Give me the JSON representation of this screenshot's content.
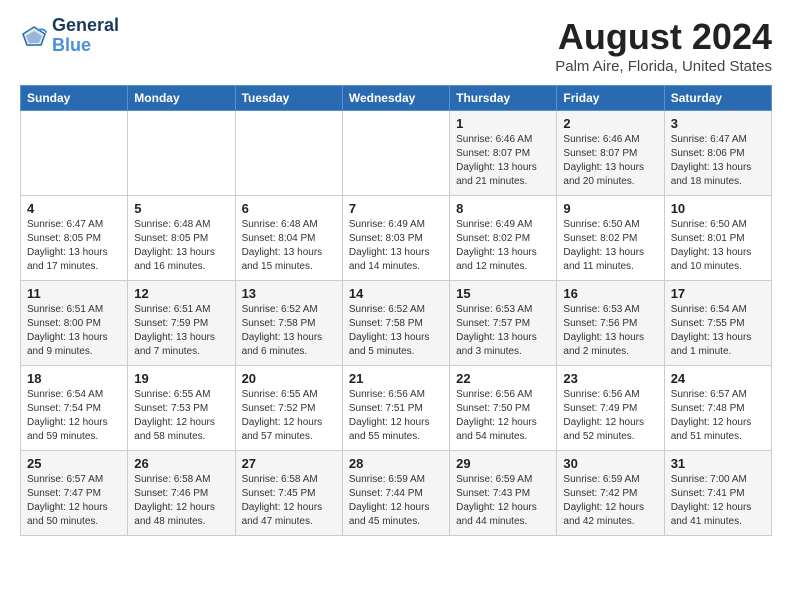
{
  "header": {
    "logo_line1": "General",
    "logo_line2": "Blue",
    "title": "August 2024",
    "subtitle": "Palm Aire, Florida, United States"
  },
  "weekdays": [
    "Sunday",
    "Monday",
    "Tuesday",
    "Wednesday",
    "Thursday",
    "Friday",
    "Saturday"
  ],
  "weeks": [
    [
      {
        "day": "",
        "info": ""
      },
      {
        "day": "",
        "info": ""
      },
      {
        "day": "",
        "info": ""
      },
      {
        "day": "",
        "info": ""
      },
      {
        "day": "1",
        "info": "Sunrise: 6:46 AM\nSunset: 8:07 PM\nDaylight: 13 hours\nand 21 minutes."
      },
      {
        "day": "2",
        "info": "Sunrise: 6:46 AM\nSunset: 8:07 PM\nDaylight: 13 hours\nand 20 minutes."
      },
      {
        "day": "3",
        "info": "Sunrise: 6:47 AM\nSunset: 8:06 PM\nDaylight: 13 hours\nand 18 minutes."
      }
    ],
    [
      {
        "day": "4",
        "info": "Sunrise: 6:47 AM\nSunset: 8:05 PM\nDaylight: 13 hours\nand 17 minutes."
      },
      {
        "day": "5",
        "info": "Sunrise: 6:48 AM\nSunset: 8:05 PM\nDaylight: 13 hours\nand 16 minutes."
      },
      {
        "day": "6",
        "info": "Sunrise: 6:48 AM\nSunset: 8:04 PM\nDaylight: 13 hours\nand 15 minutes."
      },
      {
        "day": "7",
        "info": "Sunrise: 6:49 AM\nSunset: 8:03 PM\nDaylight: 13 hours\nand 14 minutes."
      },
      {
        "day": "8",
        "info": "Sunrise: 6:49 AM\nSunset: 8:02 PM\nDaylight: 13 hours\nand 12 minutes."
      },
      {
        "day": "9",
        "info": "Sunrise: 6:50 AM\nSunset: 8:02 PM\nDaylight: 13 hours\nand 11 minutes."
      },
      {
        "day": "10",
        "info": "Sunrise: 6:50 AM\nSunset: 8:01 PM\nDaylight: 13 hours\nand 10 minutes."
      }
    ],
    [
      {
        "day": "11",
        "info": "Sunrise: 6:51 AM\nSunset: 8:00 PM\nDaylight: 13 hours\nand 9 minutes."
      },
      {
        "day": "12",
        "info": "Sunrise: 6:51 AM\nSunset: 7:59 PM\nDaylight: 13 hours\nand 7 minutes."
      },
      {
        "day": "13",
        "info": "Sunrise: 6:52 AM\nSunset: 7:58 PM\nDaylight: 13 hours\nand 6 minutes."
      },
      {
        "day": "14",
        "info": "Sunrise: 6:52 AM\nSunset: 7:58 PM\nDaylight: 13 hours\nand 5 minutes."
      },
      {
        "day": "15",
        "info": "Sunrise: 6:53 AM\nSunset: 7:57 PM\nDaylight: 13 hours\nand 3 minutes."
      },
      {
        "day": "16",
        "info": "Sunrise: 6:53 AM\nSunset: 7:56 PM\nDaylight: 13 hours\nand 2 minutes."
      },
      {
        "day": "17",
        "info": "Sunrise: 6:54 AM\nSunset: 7:55 PM\nDaylight: 13 hours\nand 1 minute."
      }
    ],
    [
      {
        "day": "18",
        "info": "Sunrise: 6:54 AM\nSunset: 7:54 PM\nDaylight: 12 hours\nand 59 minutes."
      },
      {
        "day": "19",
        "info": "Sunrise: 6:55 AM\nSunset: 7:53 PM\nDaylight: 12 hours\nand 58 minutes."
      },
      {
        "day": "20",
        "info": "Sunrise: 6:55 AM\nSunset: 7:52 PM\nDaylight: 12 hours\nand 57 minutes."
      },
      {
        "day": "21",
        "info": "Sunrise: 6:56 AM\nSunset: 7:51 PM\nDaylight: 12 hours\nand 55 minutes."
      },
      {
        "day": "22",
        "info": "Sunrise: 6:56 AM\nSunset: 7:50 PM\nDaylight: 12 hours\nand 54 minutes."
      },
      {
        "day": "23",
        "info": "Sunrise: 6:56 AM\nSunset: 7:49 PM\nDaylight: 12 hours\nand 52 minutes."
      },
      {
        "day": "24",
        "info": "Sunrise: 6:57 AM\nSunset: 7:48 PM\nDaylight: 12 hours\nand 51 minutes."
      }
    ],
    [
      {
        "day": "25",
        "info": "Sunrise: 6:57 AM\nSunset: 7:47 PM\nDaylight: 12 hours\nand 50 minutes."
      },
      {
        "day": "26",
        "info": "Sunrise: 6:58 AM\nSunset: 7:46 PM\nDaylight: 12 hours\nand 48 minutes."
      },
      {
        "day": "27",
        "info": "Sunrise: 6:58 AM\nSunset: 7:45 PM\nDaylight: 12 hours\nand 47 minutes."
      },
      {
        "day": "28",
        "info": "Sunrise: 6:59 AM\nSunset: 7:44 PM\nDaylight: 12 hours\nand 45 minutes."
      },
      {
        "day": "29",
        "info": "Sunrise: 6:59 AM\nSunset: 7:43 PM\nDaylight: 12 hours\nand 44 minutes."
      },
      {
        "day": "30",
        "info": "Sunrise: 6:59 AM\nSunset: 7:42 PM\nDaylight: 12 hours\nand 42 minutes."
      },
      {
        "day": "31",
        "info": "Sunrise: 7:00 AM\nSunset: 7:41 PM\nDaylight: 12 hours\nand 41 minutes."
      }
    ]
  ]
}
